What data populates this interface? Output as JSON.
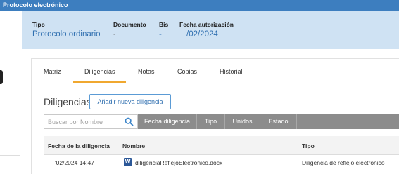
{
  "window": {
    "title": "Protocolo electrónico"
  },
  "header": {
    "fields": [
      {
        "label": "Tipo",
        "value": "Protocolo ordinario"
      },
      {
        "label": "Documento",
        "value": "."
      },
      {
        "label": "Bis",
        "value": "-"
      },
      {
        "label": "Fecha autorización",
        "value": "/02/2024"
      }
    ]
  },
  "tabs": [
    {
      "label": "Matriz"
    },
    {
      "label": "Diligencias"
    },
    {
      "label": "Notas"
    },
    {
      "label": "Copias"
    },
    {
      "label": "Historial"
    }
  ],
  "section": {
    "title": "Diligencias",
    "add_button": "Añadir nueva diligencia"
  },
  "filter": {
    "search_placeholder": "Buscar por Nombre",
    "columns": [
      "Fecha diligencia",
      "Tipo",
      "Unidos",
      "Estado"
    ]
  },
  "table": {
    "columns": [
      "Fecha de la diligencia",
      "Nombre",
      "Tipo"
    ],
    "rows": [
      {
        "fecha": "'02/2024 14:47",
        "nombre": "diligenciaReflejoElectronico.docx",
        "tipo": "Diligencia de reflejo electrónico"
      }
    ]
  },
  "colors": {
    "titlebar": "#3d7ebf",
    "band": "#cfe2f3",
    "accent": "#f0a830",
    "link": "#2f6fb0",
    "filter": "#8c8c8c"
  },
  "icons": {
    "search": "search-icon",
    "word": "word-document-icon"
  }
}
